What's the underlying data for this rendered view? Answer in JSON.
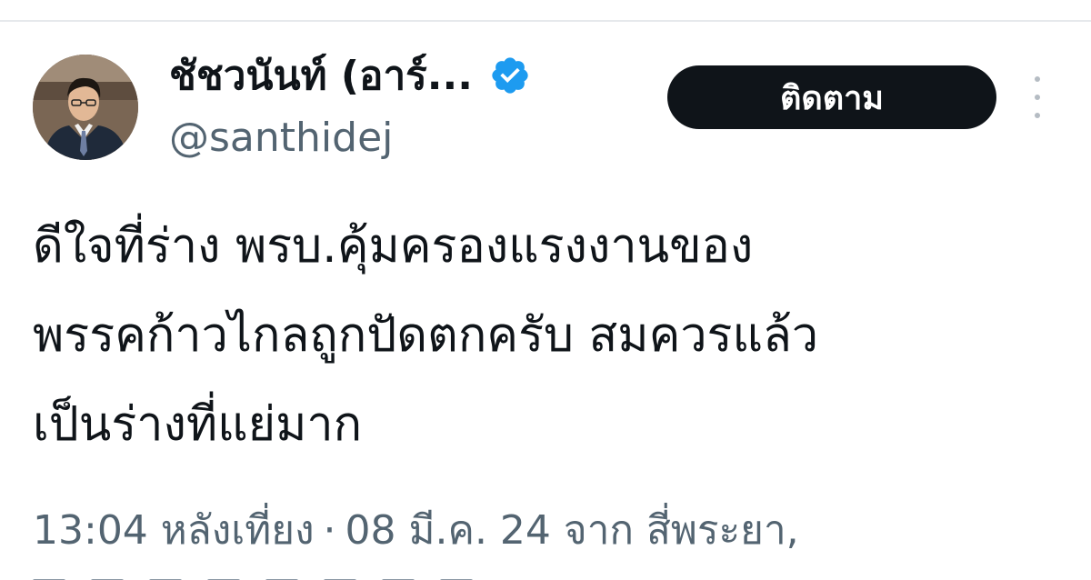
{
  "tweet": {
    "author": {
      "display_name": "ชัชวนันท์ (อาร์...",
      "handle": "@santhidej",
      "verified_icon": "verified-badge-icon",
      "avatar_icon": "profile-photo"
    },
    "follow_label": "ติดตาม",
    "more_icon": "more-vertical-icon",
    "text_lines": [
      "ดีใจที่ร่าง พรบ.คุ้มครองแรงงานของ",
      "พรรคก้าวไกลถูกปัดตกครับ สมควรแล้ว",
      "เป็นร่างที่แย่มาก"
    ],
    "meta": {
      "time": "13:04 หลังเที่ยง",
      "separator": "·",
      "date": "08 มี.ค. 24",
      "from_label": "จาก",
      "location": "สี่พระยา,"
    }
  },
  "colors": {
    "text_primary": "#0f1419",
    "text_secondary": "#536471",
    "verified": "#1d9bf0",
    "follow_bg": "#0f1419",
    "follow_text": "#ffffff"
  }
}
